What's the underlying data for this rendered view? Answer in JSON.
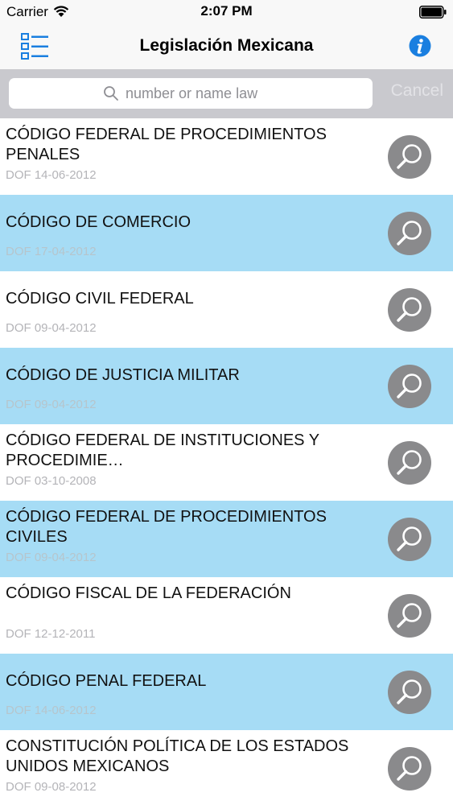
{
  "status_bar": {
    "carrier": "Carrier",
    "time": "2:07 PM"
  },
  "nav": {
    "title": "Legislación Mexicana",
    "menu_icon": "list-icon",
    "info_icon": "info-icon"
  },
  "search": {
    "placeholder": "number or name law",
    "value": "",
    "cancel_label": "Cancel"
  },
  "colors": {
    "accent": "#1a7fe0",
    "highlight_row": "#a6dcf5",
    "magnifier_button": "#8a8a8c"
  },
  "laws": [
    {
      "title": "CÓDIGO FEDERAL DE PROCEDIMIENTOS PENALES",
      "date": "DOF 14-06-2012"
    },
    {
      "title": "CÓDIGO DE COMERCIO",
      "date": "DOF 17-04-2012"
    },
    {
      "title": "CÓDIGO CIVIL FEDERAL",
      "date": "DOF 09-04-2012"
    },
    {
      "title": "CÓDIGO DE JUSTICIA MILITAR",
      "date": "DOF 09-04-2012"
    },
    {
      "title": "CÓDIGO FEDERAL DE INSTITUCIONES Y PROCEDIMIE…",
      "date": "DOF 03-10-2008"
    },
    {
      "title": "CÓDIGO FEDERAL DE PROCEDIMIENTOS CIVILES",
      "date": "DOF 09-04-2012"
    },
    {
      "title": "CÓDIGO FISCAL DE LA FEDERACIÓN",
      "date": "DOF 12-12-2011"
    },
    {
      "title": "CÓDIGO PENAL FEDERAL",
      "date": "DOF 14-06-2012"
    },
    {
      "title": "CONSTITUCIÓN POLÍTICA DE LOS ESTADOS UNIDOS MEXICANOS",
      "date": "DOF 09-08-2012"
    }
  ]
}
